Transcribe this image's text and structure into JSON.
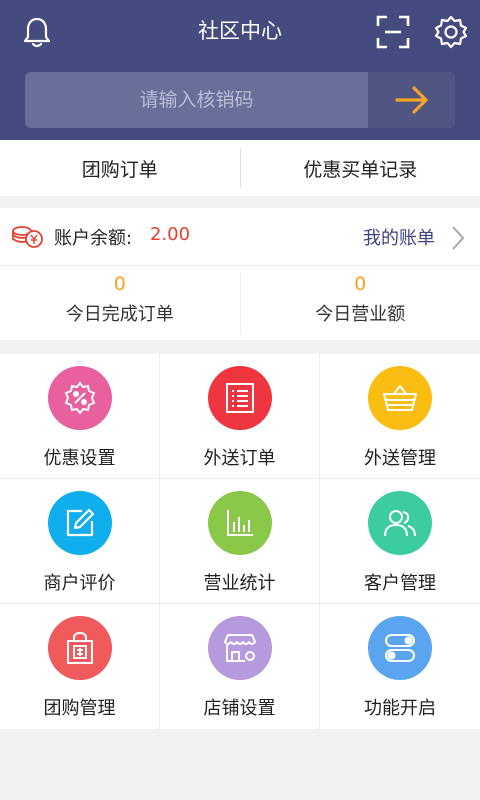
{
  "header": {
    "title": "社区中心",
    "bg_color": "#454b7e",
    "icons": [
      "bell-icon",
      "scan-icon",
      "gear-icon"
    ]
  },
  "search": {
    "placeholder": "请输入核销码",
    "submit_icon": "arrow-right-icon",
    "accent": "#f5a523"
  },
  "tabs": [
    {
      "label": "团购订单"
    },
    {
      "label": "优惠买单记录"
    }
  ],
  "balance": {
    "label": "账户余额:",
    "value": "2.00",
    "link": "我的账单",
    "icon": "money-icon"
  },
  "stats": [
    {
      "value": "0",
      "label": "今日完成订单"
    },
    {
      "value": "0",
      "label": "今日营业额"
    }
  ],
  "grid": [
    {
      "label": "优惠设置",
      "icon": "discount-icon",
      "color": "#e9609e"
    },
    {
      "label": "外送订单",
      "icon": "list-icon",
      "color": "#ef3640"
    },
    {
      "label": "外送管理",
      "icon": "basket-icon",
      "color": "#f9be11"
    },
    {
      "label": "商户评价",
      "icon": "edit-icon",
      "color": "#11aeee"
    },
    {
      "label": "营业统计",
      "icon": "bar-chart-icon",
      "color": "#8ac84a"
    },
    {
      "label": "客户管理",
      "icon": "users-icon",
      "color": "#3dcca2"
    },
    {
      "label": "团购管理",
      "icon": "bag-icon",
      "color": "#f15a5a"
    },
    {
      "label": "店铺设置",
      "icon": "store-icon",
      "color": "#b59ade"
    },
    {
      "label": "功能开启",
      "icon": "toggle-icon",
      "color": "#5aa4f0"
    }
  ]
}
